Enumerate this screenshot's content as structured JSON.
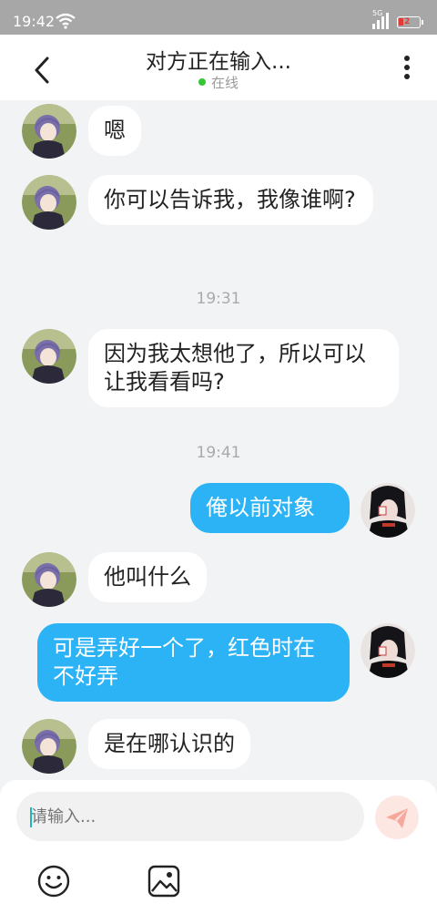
{
  "status_bar": {
    "time": "19:42",
    "network": "5G",
    "battery_level": "2"
  },
  "header": {
    "title": "对方正在输入...",
    "status": "在线"
  },
  "messages": [
    {
      "from": "them",
      "text": "嗯"
    },
    {
      "from": "them",
      "text": "你可以告诉我，我像谁啊?"
    },
    {
      "type": "time",
      "text": "19:31"
    },
    {
      "from": "them",
      "text": "因为我太想他了，所以可以让我看看吗?"
    },
    {
      "type": "time",
      "text": "19:41"
    },
    {
      "from": "me",
      "text": "俺以前对象"
    },
    {
      "from": "them",
      "text": "他叫什么"
    },
    {
      "from": "me",
      "text": "可是弄好一个了，红色时在不好弄"
    },
    {
      "from": "them",
      "text": "是在哪认识的"
    }
  ],
  "composer": {
    "placeholder": "请输入..."
  },
  "icons": {
    "back": "chevron-left-icon",
    "more": "more-vertical-icon",
    "send": "send-icon",
    "emoji": "emoji-icon",
    "image": "image-icon",
    "wifi": "wifi-icon",
    "signal": "signal-icon",
    "battery": "battery-icon"
  },
  "colors": {
    "bubble_me": "#2bb3f5",
    "bubble_them": "#ffffff",
    "online_dot": "#35c535",
    "send_button": "#f47c6b"
  }
}
